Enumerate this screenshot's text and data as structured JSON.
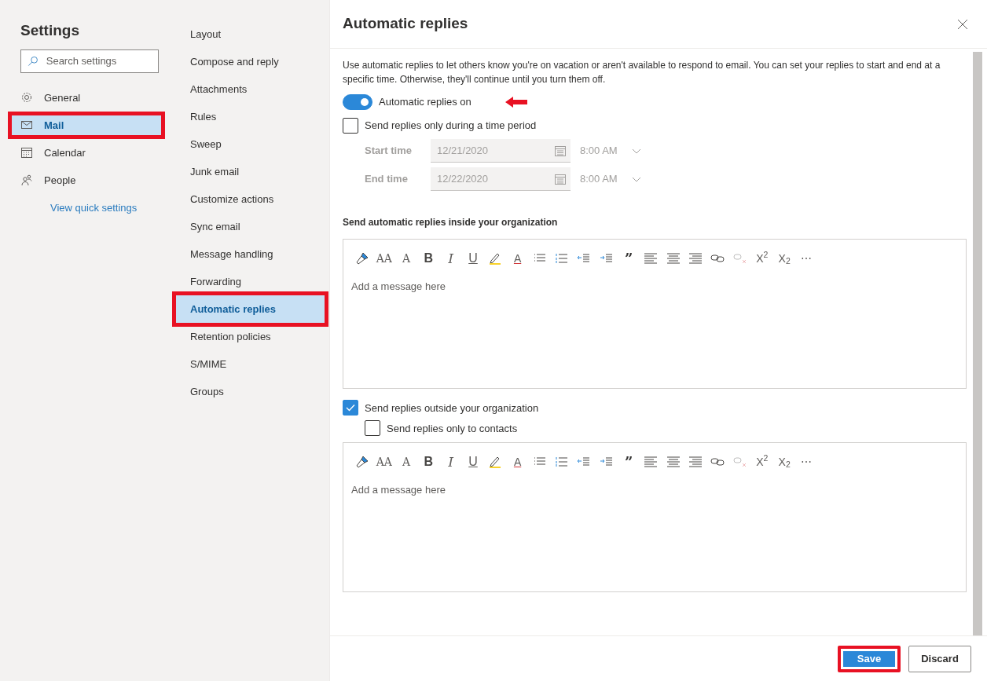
{
  "settings_nav": {
    "title": "Settings",
    "search": {
      "placeholder": "Search settings"
    },
    "items": [
      {
        "label": "General",
        "kind": "gear",
        "selected": false,
        "highlighted": false
      },
      {
        "label": "Mail",
        "kind": "mail",
        "selected": true,
        "highlighted": true
      },
      {
        "label": "Calendar",
        "kind": "calendar",
        "selected": false,
        "highlighted": false
      },
      {
        "label": "People",
        "kind": "people",
        "selected": false,
        "highlighted": false
      }
    ],
    "link": "View quick settings"
  },
  "mail_nav": {
    "items": [
      {
        "label": "Layout",
        "selected": false,
        "highlighted": false
      },
      {
        "label": "Compose and reply",
        "selected": false,
        "highlighted": false
      },
      {
        "label": "Attachments",
        "selected": false,
        "highlighted": false
      },
      {
        "label": "Rules",
        "selected": false,
        "highlighted": false
      },
      {
        "label": "Sweep",
        "selected": false,
        "highlighted": false
      },
      {
        "label": "Junk email",
        "selected": false,
        "highlighted": false
      },
      {
        "label": "Customize actions",
        "selected": false,
        "highlighted": false
      },
      {
        "label": "Sync email",
        "selected": false,
        "highlighted": false
      },
      {
        "label": "Message handling",
        "selected": false,
        "highlighted": false
      },
      {
        "label": "Forwarding",
        "selected": false,
        "highlighted": false
      },
      {
        "label": "Automatic replies",
        "selected": true,
        "highlighted": true
      },
      {
        "label": "Retention policies",
        "selected": false,
        "highlighted": false
      },
      {
        "label": "S/MIME",
        "selected": false,
        "highlighted": false
      },
      {
        "label": "Groups",
        "selected": false,
        "highlighted": false
      }
    ]
  },
  "panel": {
    "title": "Automatic replies",
    "description": "Use automatic replies to let others know you're on vacation or aren't available to respond to email. You can set your replies to start and end at a specific time. Otherwise, they'll continue until you turn them off.",
    "toggle": {
      "label": "Automatic replies on",
      "on": true,
      "pointer_arrow": true
    },
    "time_period": {
      "label": "Send replies only during a time period",
      "checked": false,
      "rows": [
        {
          "label": "Start time",
          "date": "12/21/2020",
          "time": "8:00 AM",
          "disabled": true
        },
        {
          "label": "End time",
          "date": "12/22/2020",
          "time": "8:00 AM",
          "disabled": true
        }
      ]
    },
    "inside": {
      "heading": "Send automatic replies inside your organization",
      "editor": {
        "placeholder": "Add a message here",
        "toolbar": [
          {
            "kind": "paint",
            "disabled": false
          },
          {
            "kind": "font-size",
            "glyph": "AA",
            "disabled": false
          },
          {
            "kind": "grow",
            "glyph": "A",
            "disabled": false
          },
          {
            "kind": "bold",
            "glyph": "B",
            "disabled": false
          },
          {
            "kind": "italic",
            "glyph": "I",
            "disabled": false
          },
          {
            "kind": "underline",
            "glyph": "U",
            "disabled": false
          },
          {
            "kind": "highlight",
            "disabled": false
          },
          {
            "kind": "font-color",
            "glyph": "A",
            "disabled": false
          },
          {
            "kind": "bullets",
            "disabled": false
          },
          {
            "kind": "numbering",
            "disabled": false
          },
          {
            "kind": "outdent",
            "disabled": false
          },
          {
            "kind": "indent",
            "disabled": false
          },
          {
            "kind": "quote",
            "glyph": "”",
            "disabled": false
          },
          {
            "kind": "align-left",
            "disabled": false
          },
          {
            "kind": "align-center",
            "disabled": false
          },
          {
            "kind": "align-right",
            "disabled": false
          },
          {
            "kind": "link",
            "disabled": false
          },
          {
            "kind": "unlink",
            "disabled": true
          },
          {
            "kind": "superscript",
            "glyph": "X$^{2}$",
            "disabled": false
          },
          {
            "kind": "subscript",
            "glyph": "X$_{2}$",
            "disabled": false
          },
          {
            "kind": "more",
            "glyph": "⋯",
            "disabled": false
          }
        ]
      }
    },
    "outside": {
      "label": "Send replies outside your organization",
      "checked": true,
      "contacts": {
        "label": "Send replies only to contacts",
        "checked": false
      },
      "editor": {
        "placeholder": "Add a message here",
        "toolbar": [
          {
            "kind": "paint",
            "disabled": false
          },
          {
            "kind": "font-size",
            "glyph": "AA",
            "disabled": false
          },
          {
            "kind": "grow",
            "glyph": "A",
            "disabled": false
          },
          {
            "kind": "bold",
            "glyph": "B",
            "disabled": false
          },
          {
            "kind": "italic",
            "glyph": "I",
            "disabled": false
          },
          {
            "kind": "underline",
            "glyph": "U",
            "disabled": false
          },
          {
            "kind": "highlight",
            "disabled": false
          },
          {
            "kind": "font-color",
            "glyph": "A",
            "disabled": false
          },
          {
            "kind": "bullets",
            "disabled": false
          },
          {
            "kind": "numbering",
            "disabled": false
          },
          {
            "kind": "outdent",
            "disabled": false
          },
          {
            "kind": "indent",
            "disabled": false
          },
          {
            "kind": "quote",
            "glyph": "”",
            "disabled": false
          },
          {
            "kind": "align-left",
            "disabled": false
          },
          {
            "kind": "align-center",
            "disabled": false
          },
          {
            "kind": "align-right",
            "disabled": false
          },
          {
            "kind": "link",
            "disabled": false
          },
          {
            "kind": "unlink",
            "disabled": true
          },
          {
            "kind": "superscript",
            "glyph": "X$^{2}$",
            "disabled": false
          },
          {
            "kind": "subscript",
            "glyph": "X$_{2}$",
            "disabled": false
          },
          {
            "kind": "more",
            "glyph": "⋯",
            "disabled": false
          }
        ]
      }
    },
    "buttons": [
      {
        "label": "Save",
        "kind": "primary",
        "highlighted": true
      },
      {
        "label": "Discard",
        "kind": "secondary",
        "highlighted": false
      }
    ]
  }
}
